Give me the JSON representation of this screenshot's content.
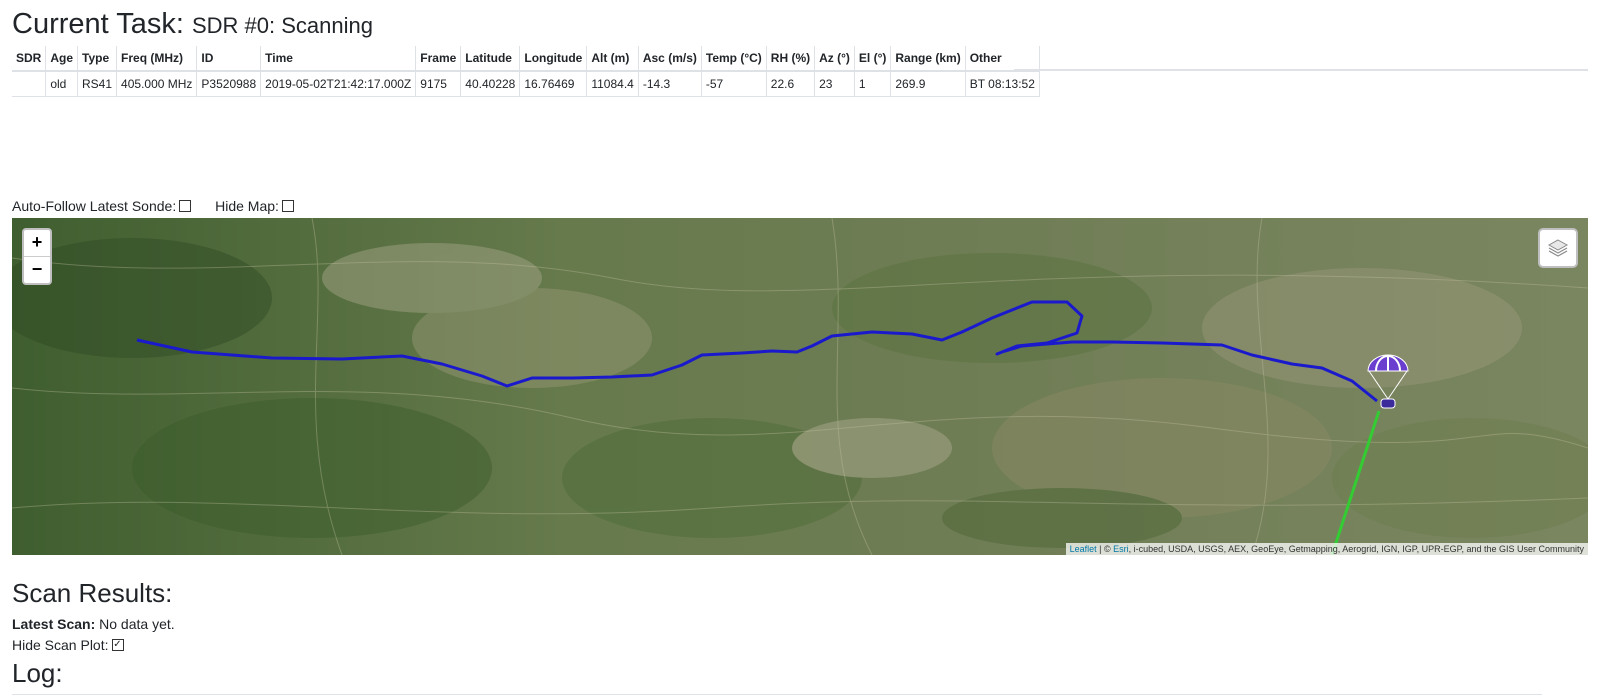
{
  "task": {
    "label": "Current Task:",
    "value": "SDR #0: Scanning"
  },
  "telemetry": {
    "headers": [
      "SDR",
      "Age",
      "Type",
      "Freq (MHz)",
      "ID",
      "Time",
      "Frame",
      "Latitude",
      "Longitude",
      "Alt (m)",
      "Asc (m/s)",
      "Temp (°C)",
      "RH (%)",
      "Az (°)",
      "El (°)",
      "Range (km)",
      "Other"
    ],
    "row": [
      "",
      "old",
      "RS41",
      "405.000 MHz",
      "P3520988",
      "2019-05-02T21:42:17.000Z",
      "9175",
      "40.40228",
      "16.76469",
      "11084.4",
      "-14.3",
      "-57",
      "22.6",
      "23",
      "1",
      "269.9",
      "BT 08:13:52"
    ]
  },
  "controls": {
    "auto_follow_label": "Auto-Follow Latest Sonde:",
    "auto_follow_checked": false,
    "hide_map_label": "Hide Map:",
    "hide_map_checked": false
  },
  "map": {
    "zoom_in": "+",
    "zoom_out": "−",
    "attribution_leaflet": "Leaflet",
    "attribution_sep": " | © ",
    "attribution_esri": "Esri",
    "attribution_rest": ", i-cubed, USDA, USGS, AEX, GeoEye, Getmapping, Aerogrid, IGN, IGP, UPR-EGP, and the GIS User Community",
    "track_color": "#1a1acc",
    "los_color": "#33cc33",
    "parachute_color": "#6a3fd0"
  },
  "scan": {
    "heading": "Scan Results:",
    "latest_label": "Latest Scan:",
    "latest_value": "No data yet.",
    "hide_plot_label": "Hide Scan Plot:",
    "hide_plot_checked": true
  },
  "log": {
    "heading": "Log:"
  }
}
